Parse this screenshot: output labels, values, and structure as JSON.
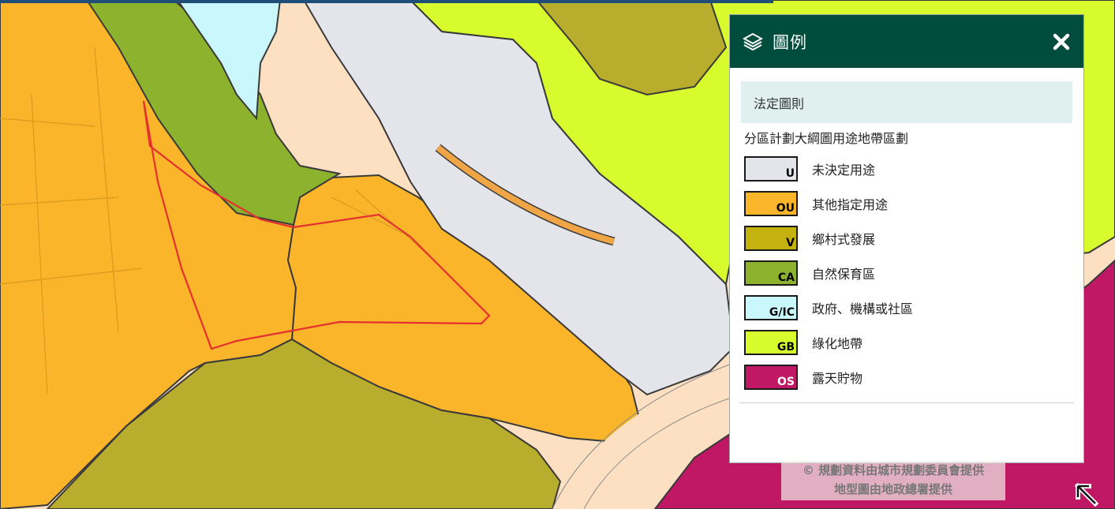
{
  "legend": {
    "title": "圖例",
    "section": "法定圖則",
    "subtitle": "分區計劃大綱圖用途地帶區劃",
    "items": [
      {
        "code": "U",
        "label": "未決定用途",
        "color": "#e3e5ea",
        "text_color": "#000000"
      },
      {
        "code": "OU",
        "label": "其他指定用途",
        "color": "#fbb52a",
        "text_color": "#000000"
      },
      {
        "code": "V",
        "label": "鄉村式發展",
        "color": "#c4b20f",
        "text_color": "#000000"
      },
      {
        "code": "CA",
        "label": "自然保育區",
        "color": "#8db22e",
        "text_color": "#000000"
      },
      {
        "code": "G/IC",
        "label": "政府、機構或社區",
        "color": "#c9f7fb",
        "text_color": "#000000"
      },
      {
        "code": "GB",
        "label": "綠化地帶",
        "color": "#d8fb2e",
        "text_color": "#000000"
      },
      {
        "code": "OS",
        "label": "露天貯物",
        "color": "#c01865",
        "text_color": "#ffffff"
      }
    ],
    "icons": {
      "header": "layers-icon",
      "close": "close-icon"
    }
  },
  "attribution": {
    "line1": "© 規劃資料由城市規劃委員會提供",
    "line2": "地型圖由地政總署提供"
  },
  "map": {
    "colors": {
      "ou": "#fbb52a",
      "v": "#b8ad2c",
      "ca": "#8db22e",
      "gic": "#c9f7fb",
      "gb": "#d8fb2e",
      "u": "#e3e5ea",
      "os": "#c01865",
      "road": "#fde0c2",
      "boundary": "#e53030"
    }
  },
  "controls": {
    "expand_icon": "expand-arrow-icon"
  }
}
